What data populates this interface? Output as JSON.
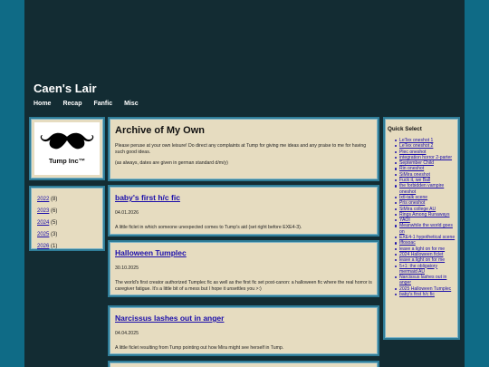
{
  "site": {
    "title": "Caen's Lair",
    "nav": [
      "Home",
      "Recap",
      "Fanfic",
      "Misc"
    ]
  },
  "logo": {
    "text": "Tump Inc™"
  },
  "years": [
    {
      "year": "2022",
      "count": "(8)"
    },
    {
      "year": "2023",
      "count": "(6)"
    },
    {
      "year": "2024",
      "count": "(5)"
    },
    {
      "year": "2025",
      "count": "(3)"
    },
    {
      "year": "2026",
      "count": "(1)"
    }
  ],
  "intro": {
    "title": "Archive of My Own",
    "text": "Please peruse at your own leisure! Do direct any complaints at Tump for giving me ideas and any praise to me for having such good ideas.",
    "note": "(as always, dates are given in german standard d/m/y)"
  },
  "posts": [
    {
      "title": "baby's first h/c fic",
      "date": "04.01.2026",
      "desc": "A little ficlet in which someone unexpected comes to Tump's aid (set right before EXE4-3)."
    },
    {
      "title": "Halloween Tumplec",
      "date": "30.10.2025",
      "desc": "The world's first creator authorized Tumplec fic as well as the first fic set post-canon: a halloween fic where the real horror is caregiver fatigue. It's a little bit of a mess but I hope it unsettles you >:)"
    },
    {
      "title": "Narcissus lashes out in anger",
      "date": "04.04.2025",
      "desc": "A little ficlet resulting from Tump pointing out how Mira might see herself in Tump."
    },
    {
      "title": "",
      "date": "",
      "desc": ""
    }
  ],
  "quick_select": {
    "title": "Quick Select",
    "items": [
      "LeTex oneshot 1",
      "LeTex oneshot 2",
      "Plec oneshot",
      "integration horror 2-parter",
      "September Child",
      "Rin oneshot",
      "SiMira oneshot",
      "Fuck it, we Ball",
      "the forbidden vampire oneshot",
      "Ixtl-talk scene",
      "Pris oneshot",
      "SiMira college AU",
      "Rings Among Runaways",
      "YAOI",
      "Meanwhile the world goes on",
      "EXE4-1 hypothetical scene",
      "Iffosoac",
      "leave a light on for me",
      "2024 Halloween ficlet",
      "leave a light on for me",
      "5+1: the obligatory mermaid AU",
      "Narcissus lashes out in anger",
      "2025 Halloween Tumplec",
      "baby's first h/c fic"
    ]
  }
}
